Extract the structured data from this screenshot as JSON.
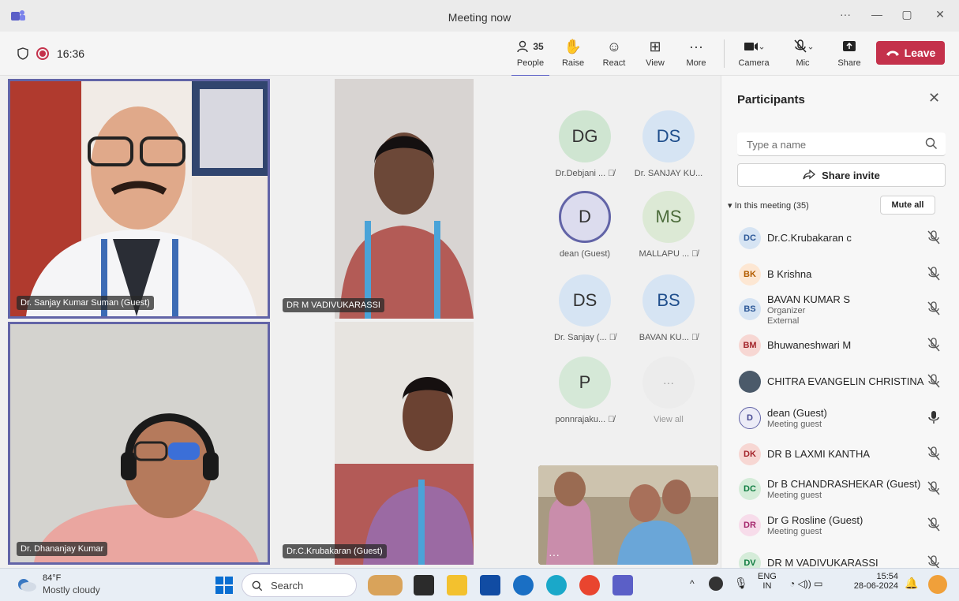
{
  "window": {
    "title": "Meeting now"
  },
  "toolbar": {
    "timer": "16:36",
    "people_count": "35",
    "people_label": "People",
    "raise_label": "Raise",
    "react_label": "React",
    "view_label": "View",
    "more_label": "More",
    "camera_label": "Camera",
    "mic_label": "Mic",
    "share_label": "Share",
    "leave_label": "Leave"
  },
  "videos": [
    {
      "name": "Dr. Sanjay Kumar Suman (Guest)",
      "bg": "#b8b0a8"
    },
    {
      "name": "DR M VADIVUKARASSI",
      "bg": "#9a8478"
    },
    {
      "name": "Dr. Dhananjay Kumar",
      "bg": "#a8a8a4"
    },
    {
      "name": "Dr.C.Krubakaran (Guest)",
      "bg": "#a07c80"
    }
  ],
  "avatars": [
    {
      "initials": "DG",
      "name": "Dr.Debjani ...",
      "bg": "#cfe5d1",
      "muted": true
    },
    {
      "initials": "DS",
      "name": "Dr. SANJAY KU...",
      "bg": "#d6e4f3",
      "muted": false
    },
    {
      "initials": "D",
      "name": "dean (Guest)",
      "bg": "#dcdcee",
      "muted": false
    },
    {
      "initials": "MS",
      "name": "MALLAPU ...",
      "bg": "#dce9d5",
      "muted": true
    },
    {
      "initials": "DS",
      "name": "Dr. Sanjay (...",
      "bg": "#d6e4f3",
      "muted": true
    },
    {
      "initials": "BS",
      "name": "BAVAN KU...",
      "bg": "#d6e4f3",
      "muted": true
    },
    {
      "initials": "P",
      "name": "ponnrajaku...",
      "bg": "#d5e8d7",
      "muted": true
    },
    {
      "initials": "···",
      "name": "View all",
      "bg": "#ececec",
      "muted": false
    }
  ],
  "panel": {
    "title": "Participants",
    "search_placeholder": "Type a name",
    "share_invite": "Share invite",
    "in_meeting": "In this meeting (35)",
    "mute_all": "Mute all",
    "participants": [
      {
        "initials": "DC",
        "name": "Dr.C.Krubakaran c",
        "sub": "",
        "sub2": "",
        "bg": "#d6e4f3",
        "fg": "#2b5797",
        "mic": "muted"
      },
      {
        "initials": "BK",
        "name": "B Krishna",
        "sub": "",
        "sub2": "",
        "bg": "#fde7d3",
        "fg": "#b35c00",
        "mic": "muted"
      },
      {
        "initials": "BS",
        "name": "BAVAN KUMAR S",
        "sub": "Organizer",
        "sub2": "External",
        "bg": "#d6e4f3",
        "fg": "#2b5797",
        "mic": "muted"
      },
      {
        "initials": "BM",
        "name": "Bhuwaneshwari M",
        "sub": "",
        "sub2": "",
        "bg": "#f7d7d3",
        "fg": "#a4262c",
        "mic": "muted"
      },
      {
        "initials": "",
        "name": "CHITRA EVANGELIN CHRISTINA",
        "sub": "",
        "sub2": "",
        "bg": "#4b5a6a",
        "fg": "#ffffff",
        "mic": "muted"
      },
      {
        "initials": "D",
        "name": "dean (Guest)",
        "sub": "Meeting guest",
        "sub2": "",
        "bg": "#ececf7",
        "fg": "#444791",
        "mic": "on"
      },
      {
        "initials": "DK",
        "name": "DR B LAXMI KANTHA",
        "sub": "",
        "sub2": "",
        "bg": "#f7d7d3",
        "fg": "#a4262c",
        "mic": "muted"
      },
      {
        "initials": "DC",
        "name": "Dr B CHANDRASHEKAR (Guest)",
        "sub": "Meeting guest",
        "sub2": "",
        "bg": "#d5ecd9",
        "fg": "#107c41",
        "mic": "muted"
      },
      {
        "initials": "DR",
        "name": "Dr G Rosline (Guest)",
        "sub": "Meeting guest",
        "sub2": "",
        "bg": "#f7dcea",
        "fg": "#a4266c",
        "mic": "muted"
      },
      {
        "initials": "DV",
        "name": "DR M VADIVUKARASSI",
        "sub": "",
        "sub2": "",
        "bg": "#d5ecd9",
        "fg": "#107c41",
        "mic": "muted"
      }
    ]
  },
  "taskbar": {
    "temp": "84°F",
    "weather": "Mostly cloudy",
    "search": "Search",
    "lang1": "ENG",
    "lang2": "IN",
    "time": "15:54",
    "date": "28-06-2024"
  }
}
